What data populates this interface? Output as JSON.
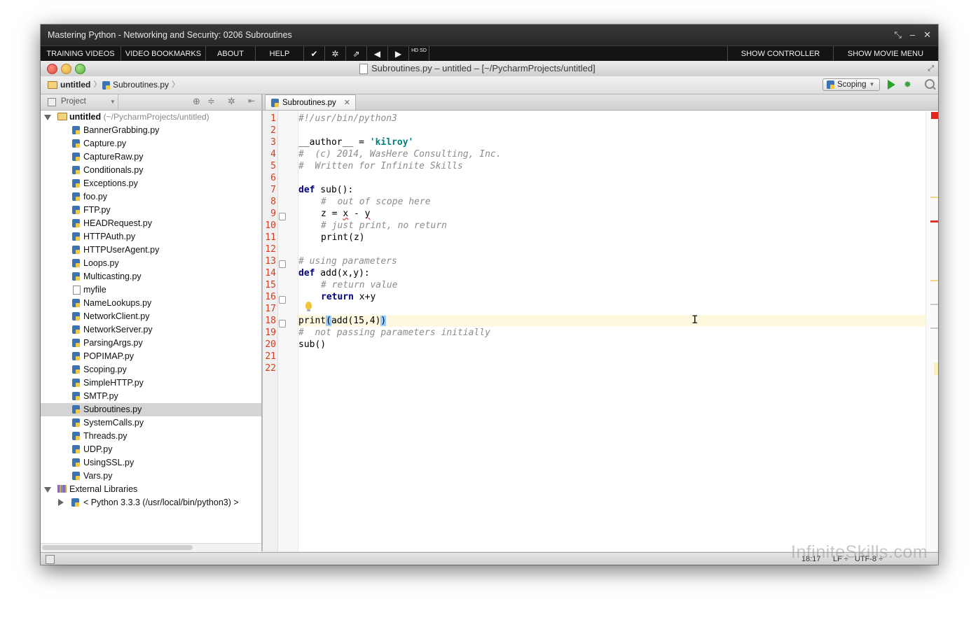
{
  "player": {
    "title": "Mastering Python - Networking and Security: 0206 Subroutines",
    "window_controls": [
      "⤡",
      "–",
      "✕"
    ],
    "menu": {
      "training_videos": "TRAINING VIDEOS",
      "video_bookmarks": "VIDEO BOOKMARKS",
      "about": "ABOUT",
      "help": "HELP",
      "hd": "HD SD",
      "show_controller": "SHOW CONTROLLER",
      "show_movie_menu": "SHOW MOVIE MENU"
    },
    "icons": [
      "check-icon",
      "gear-icon",
      "external-link-icon",
      "prev-icon",
      "next-icon",
      "hd-icon"
    ]
  },
  "ide": {
    "window_title": "Subroutines.py – untitled – [~/PycharmProjects/untitled]",
    "breadcrumb": [
      "untitled",
      "Subroutines.py"
    ],
    "run_config": "Scoping",
    "project_panel_title": "Project",
    "tree": {
      "root_label": "untitled",
      "root_path": "(~/PycharmProjects/untitled)",
      "files": [
        "BannerGrabbing.py",
        "Capture.py",
        "CaptureRaw.py",
        "Conditionals.py",
        "Exceptions.py",
        "foo.py",
        "FTP.py",
        "HEADRequest.py",
        "HTTPAuth.py",
        "HTTPUserAgent.py",
        "Loops.py",
        "Multicasting.py",
        "myfile",
        "NameLookups.py",
        "NetworkClient.py",
        "NetworkServer.py",
        "ParsingArgs.py",
        "POPIMAP.py",
        "Scoping.py",
        "SimpleHTTP.py",
        "SMTP.py",
        "Subroutines.py",
        "SystemCalls.py",
        "Threads.py",
        "UDP.py",
        "UsingSSL.py",
        "Vars.py"
      ],
      "selected": "Subroutines.py",
      "external_libraries": "External Libraries",
      "python_sdk": "< Python 3.3.3 (/usr/local/bin/python3) >"
    },
    "editor_tab": "Subroutines.py",
    "line_numbers": [
      "1",
      "2",
      "3",
      "4",
      "5",
      "6",
      "7",
      "8",
      "9",
      "10",
      "11",
      "12",
      "13",
      "14",
      "15",
      "16",
      "17",
      "18",
      "19",
      "20",
      "21",
      "22"
    ],
    "code": {
      "l1": "#!/usr/bin/python3",
      "l3a": "__author__ = ",
      "l3b": "'kilroy'",
      "l4": "#  (c) 2014, WasHere Consulting, Inc.",
      "l5": "#  Written for Infinite Skills",
      "l7kw": "def",
      "l7": " sub():",
      "l8": "#  out of scope here",
      "l9a": "z = ",
      "l9b": "x",
      "l9c": " - ",
      "l9d": "y",
      "l10": "# just print, no return",
      "l11": "print(z)",
      "l13": "# using parameters",
      "l14kw": "def",
      "l14": " add(x,y):",
      "l15": "# return value",
      "l16kw": "return",
      "l16": " x+y",
      "l18a": "print",
      "l18b": "(",
      "l18c": "add(15,4)",
      "l18d": ")",
      "l19": "#  not passing parameters initially",
      "l20": "sub()"
    },
    "status": {
      "position": "18:17",
      "line_sep": "LF ÷",
      "encoding": "UTF-8 ÷"
    },
    "watermark": "InfiniteSkills.com"
  }
}
